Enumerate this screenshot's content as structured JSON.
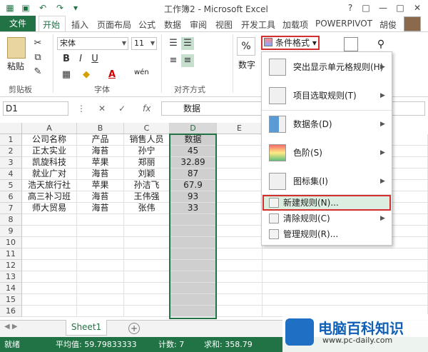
{
  "window": {
    "title": "工作簿2 - Microsoft Excel",
    "controls": [
      "?",
      "□",
      "—",
      "□",
      "✕"
    ]
  },
  "tabs": {
    "file": "文件",
    "items": [
      "开始",
      "插入",
      "页面布局",
      "公式",
      "数据",
      "审阅",
      "视图",
      "开发工具",
      "加载项",
      "POWERPIVOT"
    ],
    "user": "胡俊"
  },
  "ribbon": {
    "paste_label": "粘贴",
    "clipboard_label": "剪贴板",
    "font_name": "宋体",
    "font_size": "11",
    "bold": "B",
    "italic": "I",
    "underline": "U",
    "font_color_glyph": "A",
    "wen": "wén",
    "font_group_label": "字体",
    "align_group_label": "对齐方式",
    "number_label": "数字",
    "percent": "%",
    "cond_format_label": "条件格式"
  },
  "formula_bar": {
    "name_box": "D1",
    "fx": "fx",
    "value": "数据"
  },
  "sheet": {
    "columns": [
      "A",
      "B",
      "C",
      "D",
      "E"
    ],
    "row_numbers": [
      "1",
      "2",
      "3",
      "4",
      "5",
      "6",
      "7",
      "8",
      "9",
      "10",
      "11",
      "12",
      "13",
      "14",
      "15",
      "16"
    ],
    "rows": [
      [
        "公司名称",
        "产品",
        "销售人员",
        "数据"
      ],
      [
        "正太实业",
        "海苔",
        "孙宁",
        "45"
      ],
      [
        "凯旋科技",
        "苹果",
        "郑丽",
        "32.89"
      ],
      [
        "就业广对",
        "海苔",
        "刘颖",
        "87"
      ],
      [
        "浩天旅行社",
        "苹果",
        "孙洁飞",
        "67.9"
      ],
      [
        "高三补习班",
        "海苔",
        "王伟强",
        "93"
      ],
      [
        "师大贸易",
        "海苔",
        "张伟",
        "33"
      ]
    ]
  },
  "cf_menu": {
    "items": [
      {
        "label": "突出显示单元格规则(H)"
      },
      {
        "label": "项目选取规则(T)"
      },
      {
        "label": "数据条(D)"
      },
      {
        "label": "色阶(S)"
      },
      {
        "label": "图标集(I)"
      }
    ],
    "small_items": [
      {
        "label": "新建规则(N)..."
      },
      {
        "label": "清除规则(C)"
      },
      {
        "label": "管理规则(R)..."
      }
    ]
  },
  "sheet_tabs": {
    "active": "Sheet1",
    "add": "+"
  },
  "status": {
    "ready": "就绪",
    "average": "平均值: 59.79833333",
    "count": "计数: 7",
    "sum": "求和: 358.79"
  },
  "watermark": {
    "main": "电脑百科知识",
    "url": "www.pc-daily.com"
  },
  "colors": {
    "accent": "#217346",
    "highlight_border": "#d32f2f",
    "selection_tint": "#cfcfcf"
  }
}
